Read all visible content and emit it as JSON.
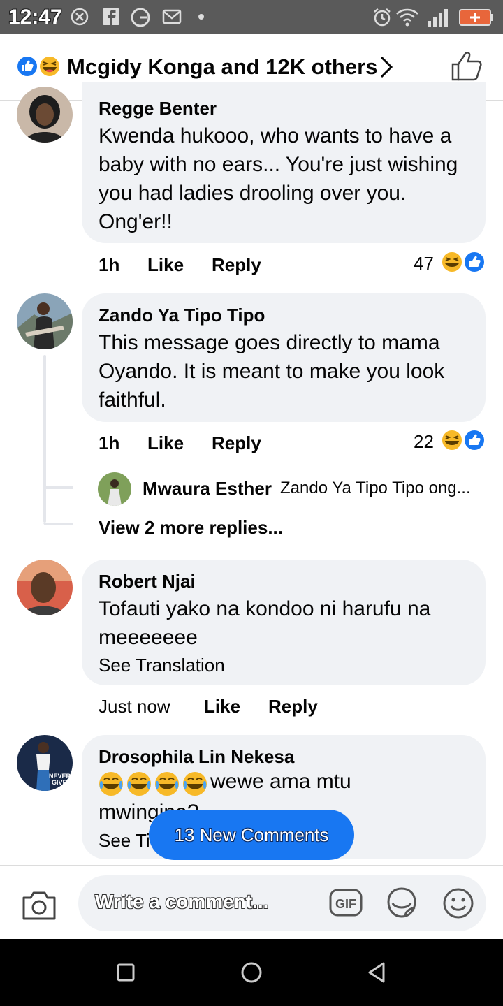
{
  "status_bar": {
    "time": "12:47",
    "icons": [
      "close-circle-icon",
      "facebook-icon",
      "google-icon",
      "gmail-icon",
      "dot-icon",
      "alarm-icon",
      "wifi-icon",
      "signal-icon",
      "battery-charging-icon"
    ]
  },
  "reactions_header": {
    "text": "Mcgidy Konga and 12K others",
    "icons": [
      "like-reaction-icon",
      "haha-reaction-icon",
      "chevron-right-icon",
      "thumbs-up-outline-icon"
    ]
  },
  "comments": [
    {
      "author": "Regge Benter",
      "text": "Kwenda hukooo, who wants to have a baby with no ears... You're just wishing you had ladies drooling over you. Ong'er!!",
      "time": "1h",
      "like": "Like",
      "reply": "Reply",
      "reaction_count": "47"
    },
    {
      "author": "Zando Ya Tipo Tipo",
      "text": "This message goes directly to mama Oyando. It is meant to make you look faithful.",
      "time": "1h",
      "like": "Like",
      "reply": "Reply",
      "reaction_count": "22",
      "replies": {
        "author": "Mwaura Esther",
        "text": "Zando Ya Tipo Tipo ong...",
        "view_more": "View 2 more replies..."
      }
    },
    {
      "author": "Robert Njai",
      "text": "Tofauti yako na kondoo ni harufu na meeeeeee",
      "see_translation": "See Translation",
      "time": "Just now",
      "like": "Like",
      "reply": "Reply"
    },
    {
      "author": "Drosophila Lin Nekesa",
      "text": "wewe ama mtu",
      "text_line2": "mwingine?",
      "see_translation": "See Ti"
    }
  ],
  "new_comments_pill": "13 New Comments",
  "composer": {
    "placeholder": "Write a comment...",
    "gif_label": "GIF",
    "icons": [
      "camera-icon",
      "gif-icon",
      "sticker-icon",
      "emoji-icon"
    ]
  },
  "nav_bar": {
    "icons": [
      "recents-square-icon",
      "home-circle-icon",
      "back-triangle-icon"
    ]
  },
  "colors": {
    "facebook_blue": "#1877f2",
    "bubble_gray": "#f0f2f5",
    "haha_yellow": "#f7b928"
  }
}
